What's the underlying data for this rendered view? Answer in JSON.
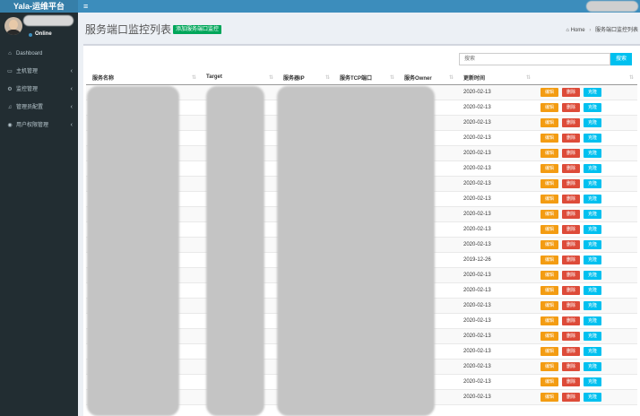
{
  "app": {
    "title": "Yala-运维平台",
    "menu_icon": "hamburger-icon"
  },
  "user": {
    "status": "Online"
  },
  "sidebar": {
    "items": [
      {
        "label": "Dashboard",
        "icon": "dashboard-icon",
        "glyph": "⌂",
        "caret": ""
      },
      {
        "label": "主机管理",
        "icon": "desktop-icon",
        "glyph": "▭",
        "caret": "‹"
      },
      {
        "label": "监控管理",
        "icon": "gear-icon",
        "glyph": "⚙",
        "caret": "‹"
      },
      {
        "label": "管理员配置",
        "icon": "bell-icon",
        "glyph": "♫",
        "caret": "‹"
      },
      {
        "label": "用户权限管理",
        "icon": "user-circle-icon",
        "glyph": "◉",
        "caret": "‹"
      }
    ]
  },
  "header": {
    "title": "服务端口监控列表",
    "add_button": "添加服务端口监控",
    "breadcrumb_home": "Home",
    "breadcrumb_current": "服务端口监控列表"
  },
  "search": {
    "placeholder": "搜索",
    "button": "搜索"
  },
  "table": {
    "columns": [
      "服务名称",
      "Target",
      "服务器IP",
      "服务TCP端口",
      "服务Owner",
      "更新时间",
      ""
    ],
    "actions": {
      "edit": "编辑",
      "delete": "删除",
      "clone": "克隆"
    },
    "rows": [
      {
        "updated": "2020-02-13"
      },
      {
        "updated": "2020-02-13"
      },
      {
        "updated": "2020-02-13"
      },
      {
        "updated": "2020-02-13"
      },
      {
        "updated": "2020-02-13"
      },
      {
        "updated": "2020-02-13"
      },
      {
        "updated": "2020-02-13"
      },
      {
        "updated": "2020-02-13"
      },
      {
        "updated": "2020-02-13"
      },
      {
        "updated": "2020-02-13"
      },
      {
        "updated": "2020-02-13"
      },
      {
        "updated": "2019-12-26"
      },
      {
        "updated": "2020-02-13"
      },
      {
        "updated": "2020-02-13"
      },
      {
        "updated": "2020-02-13"
      },
      {
        "updated": "2020-02-13"
      },
      {
        "updated": "2020-02-13"
      },
      {
        "updated": "2020-02-13"
      },
      {
        "updated": "2020-02-13"
      },
      {
        "updated": "2020-02-13"
      },
      {
        "updated": "2020-02-13"
      }
    ]
  },
  "colors": {
    "header": "#3c8dbc",
    "logo": "#367fa9",
    "sidebar": "#222d32",
    "success": "#00a65a",
    "warning": "#f39c12",
    "danger": "#dd4b39",
    "info": "#00c0ef"
  }
}
